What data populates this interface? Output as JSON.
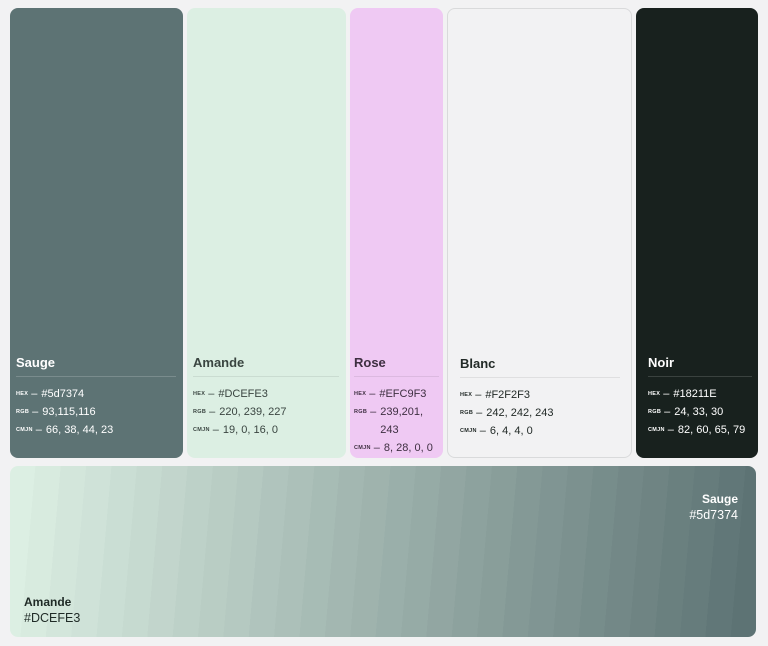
{
  "colors": {
    "sauge": "#5d7374",
    "amande": "#DCEFE3",
    "rose": "#EFC9F3",
    "blanc": "#F2F2F3",
    "noir": "#18211E"
  },
  "swatches": [
    {
      "name": "Sauge",
      "hex_label": "HEX",
      "hex": "#5d7374",
      "rgb_label": "RGB",
      "rgb": "93,115,116",
      "cmjn_label": "CMJN",
      "cmjn": "66, 38, 44, 23"
    },
    {
      "name": "Amande",
      "hex_label": "HEX",
      "hex": "#DCEFE3",
      "rgb_label": "RGB",
      "rgb": "220, 239, 227",
      "cmjn_label": "CMJN",
      "cmjn": "19, 0, 16, 0"
    },
    {
      "name": "Rose",
      "hex_label": "HEX",
      "hex": "#EFC9F3",
      "rgb_label": "RGB",
      "rgb": "239,201,\n243",
      "cmjn_label": "CMJN",
      "cmjn": "8, 28, 0, 0"
    },
    {
      "name": "Blanc",
      "hex_label": "HEX",
      "hex": "#F2F2F3",
      "rgb_label": "RGB",
      "rgb": "242, 242, 243",
      "cmjn_label": "CMJN",
      "cmjn": "6, 4, 4, 0"
    },
    {
      "name": "Noir",
      "hex_label": "HEX",
      "hex": "#18211E",
      "rgb_label": "RGB",
      "rgb": "24, 33, 30",
      "cmjn_label": "CMJN",
      "cmjn": "82, 60, 65, 79"
    }
  ],
  "gradient": {
    "end_name": "Sauge",
    "end_hex": "#5d7374",
    "start_name": "Amande",
    "start_hex": "#DCEFE3"
  }
}
